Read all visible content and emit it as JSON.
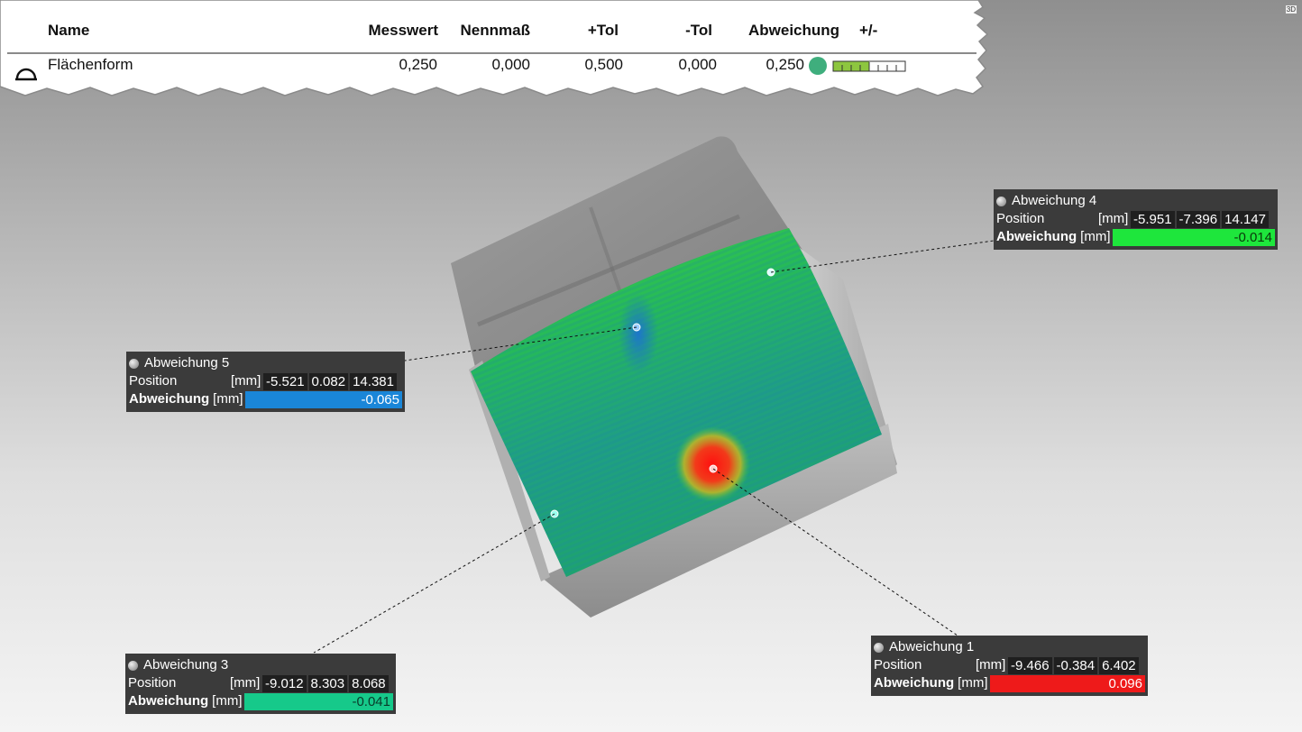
{
  "table": {
    "headers": {
      "name": "Name",
      "measured": "Messwert",
      "nominal": "Nennmaß",
      "plus_tol": "+Tol",
      "minus_tol": "-Tol",
      "deviation": "Abweichung",
      "plusminus": "+/-"
    },
    "row": {
      "icon": "flatness-icon",
      "name": "Flächenform",
      "measured": "0,250",
      "nominal": "0,000",
      "plus_tol": "0,500",
      "minus_tol": "0,000",
      "deviation": "0,250",
      "status_color": "#3fae7d",
      "bar_fill_fraction": 0.5
    }
  },
  "view_badge": "3D",
  "tags": [
    {
      "id": "tag-4",
      "title": "Abweichung 4",
      "position_label": "Position",
      "unit": "[mm]",
      "x": "-5.951",
      "y": "-7.396",
      "z": "14.147",
      "deviation_label": "Abweichung",
      "deviation_unit": "[mm]",
      "deviation": "-0.014",
      "deviation_color": "#1ee63c",
      "deviation_text_color": "#0a3a0a"
    },
    {
      "id": "tag-5",
      "title": "Abweichung 5",
      "position_label": "Position",
      "unit": "[mm]",
      "x": "-5.521",
      "y": "0.082",
      "z": "14.381",
      "deviation_label": "Abweichung",
      "deviation_unit": "[mm]",
      "deviation": "-0.065",
      "deviation_color": "#1a86d8",
      "deviation_text_color": "#ffffff"
    },
    {
      "id": "tag-3",
      "title": "Abweichung 3",
      "position_label": "Position",
      "unit": "[mm]",
      "x": "-9.012",
      "y": "8.303",
      "z": "8.068",
      "deviation_label": "Abweichung",
      "deviation_unit": "[mm]",
      "deviation": "-0.041",
      "deviation_color": "#16c98a",
      "deviation_text_color": "#0a3a2a"
    },
    {
      "id": "tag-1",
      "title": "Abweichung 1",
      "position_label": "Position",
      "unit": "[mm]",
      "x": "-9.466",
      "y": "-0.384",
      "z": "6.402",
      "deviation_label": "Abweichung",
      "deviation_unit": "[mm]",
      "deviation": "0.096",
      "deviation_color": "#ee1a1a",
      "deviation_text_color": "#ffffff"
    }
  ]
}
